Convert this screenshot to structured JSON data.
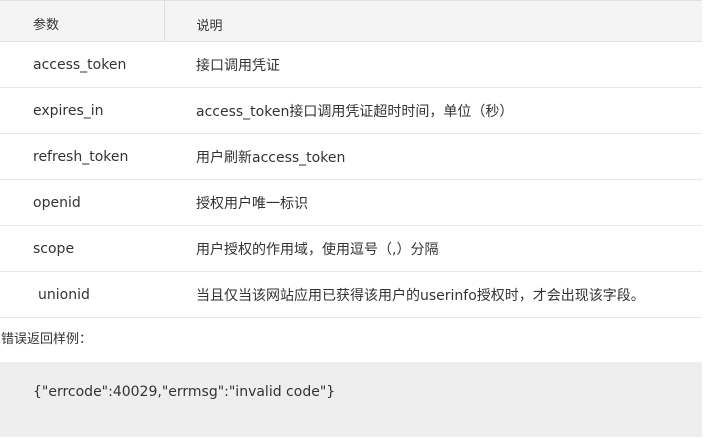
{
  "table": {
    "headers": [
      "参数",
      "说明"
    ],
    "rows": [
      {
        "param": "access_token",
        "desc": "接口调用凭证"
      },
      {
        "param": "expires_in",
        "desc": "access_token接口调用凭证超时时间，单位（秒）"
      },
      {
        "param": "refresh_token",
        "desc": "用户刷新access_token"
      },
      {
        "param": "openid",
        "desc": "授权用户唯一标识"
      },
      {
        "param": "scope",
        "desc": "用户授权的作用域，使用逗号（,）分隔"
      },
      {
        "param": "unionid",
        "desc": "当且仅当该网站应用已获得该用户的userinfo授权时，才会出现该字段。"
      }
    ]
  },
  "error_example": {
    "label": "错误返回样例：",
    "code": "{\"errcode\":40029,\"errmsg\":\"invalid code\"}"
  }
}
